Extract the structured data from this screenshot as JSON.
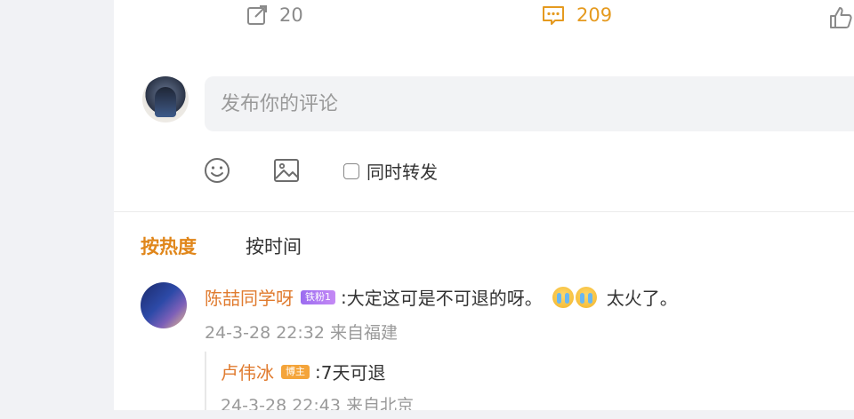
{
  "actions": {
    "forward_count": "20",
    "comment_count": "209"
  },
  "composer": {
    "placeholder": "发布你的评论",
    "repost_label": "同时转发"
  },
  "sort_tabs": {
    "hot": "按热度",
    "time": "按时间"
  },
  "comments": [
    {
      "username": "陈喆同学呀",
      "badge": "铁粉1",
      "separator": ":",
      "text_before": "大定这可是不可退的呀。",
      "text_after": "太火了。",
      "meta": "24-3-28 22:32 来自福建",
      "replies": [
        {
          "username": "卢伟冰",
          "badge": "博主",
          "separator": ":",
          "text": "7天可退",
          "meta": "24-3-28 22:43 来自北京"
        }
      ]
    }
  ],
  "colors": {
    "accent_orange": "#e0861a",
    "username": "#e07b2f",
    "meta_gray": "#9a9a9a"
  }
}
